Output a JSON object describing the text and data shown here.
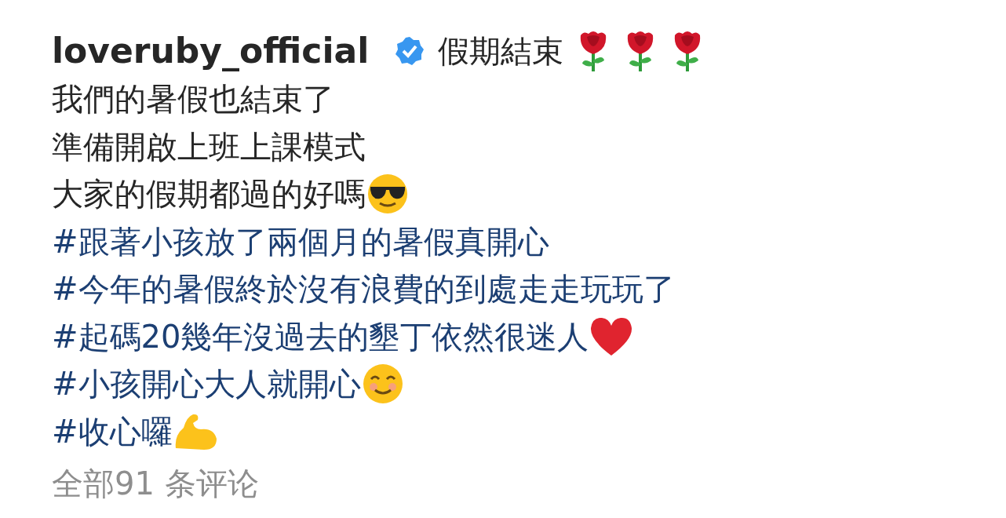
{
  "post": {
    "username": "loveruby_official",
    "verified": true,
    "headline": "假期結束"
  },
  "caption_lines": [
    {
      "kind": "text",
      "text": "我們的暑假也結束了"
    },
    {
      "kind": "text",
      "text": "準備開啟上班上課模式"
    },
    {
      "kind": "text",
      "text": "大家的假期都過的好嗎"
    },
    {
      "kind": "hashtag",
      "text": "#跟著小孩放了兩個月的暑假真開心"
    },
    {
      "kind": "hashtag",
      "text": "#今年的暑假終於沒有浪費的到處走走玩玩了"
    },
    {
      "kind": "hashtag",
      "text": "#起碼20幾年沒過去的墾丁依然很迷人"
    },
    {
      "kind": "hashtag",
      "text": "#小孩開心大人就開心"
    },
    {
      "kind": "hashtag",
      "text": "#收心囉"
    }
  ],
  "comments_link": "全部91 条评论"
}
